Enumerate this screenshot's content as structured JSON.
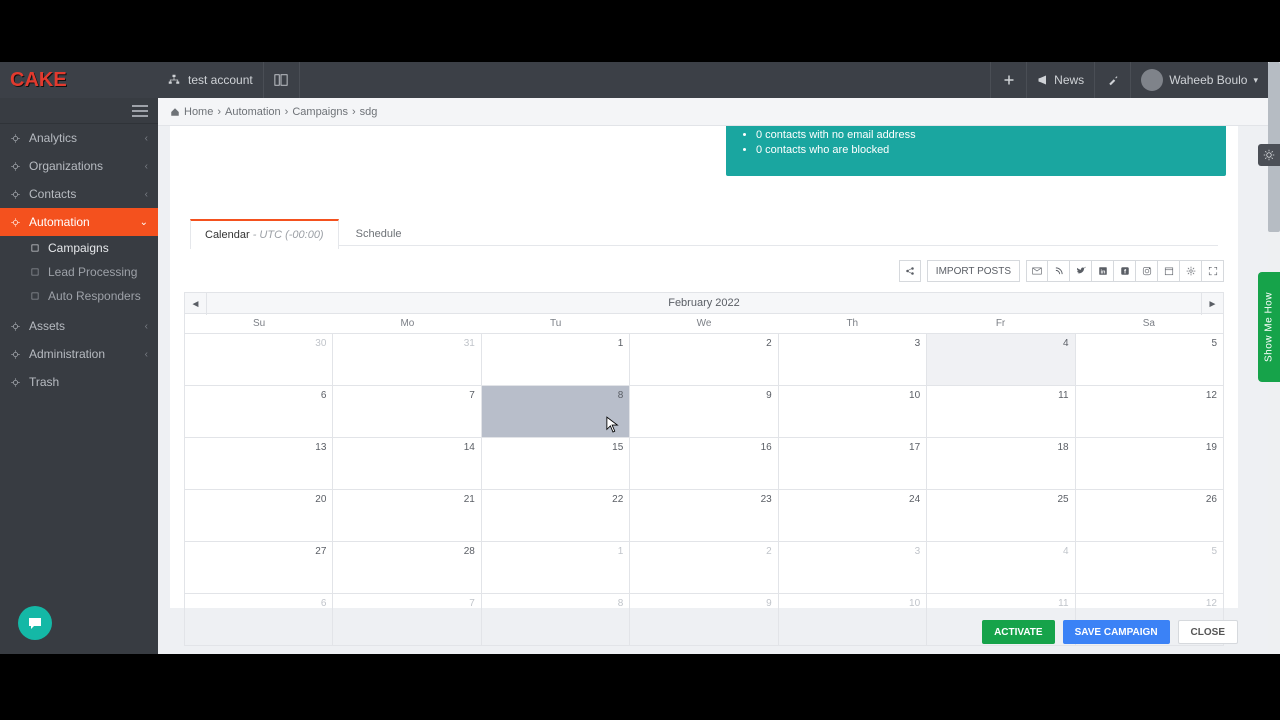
{
  "brand": "CAKE",
  "topbar": {
    "account_label": "test account",
    "news_label": "News",
    "user_name": "Waheeb Boulo"
  },
  "breadcrumb": {
    "home": "Home",
    "automation": "Automation",
    "campaigns": "Campaigns",
    "current": "sdg"
  },
  "sidebar": {
    "items": [
      {
        "label": "Analytics",
        "expandable": true
      },
      {
        "label": "Organizations",
        "expandable": true
      },
      {
        "label": "Contacts",
        "expandable": true
      },
      {
        "label": "Automation",
        "expandable": true,
        "active": true
      },
      {
        "label": "Assets",
        "expandable": true
      },
      {
        "label": "Administration",
        "expandable": true
      },
      {
        "label": "Trash",
        "expandable": false
      }
    ],
    "automation_children": [
      {
        "label": "Campaigns",
        "selected": true
      },
      {
        "label": "Lead Processing",
        "selected": false
      },
      {
        "label": "Auto Responders",
        "selected": false
      }
    ]
  },
  "notice": {
    "lines": [
      "0 contacts with no email address",
      "0 contacts who are blocked"
    ]
  },
  "tabs": {
    "calendar_label": "Calendar",
    "calendar_tz": " - UTC (-00:00)",
    "schedule_label": "Schedule"
  },
  "toolbar": {
    "import_label": "IMPORT POSTS"
  },
  "calendar": {
    "title": "February 2022",
    "dow": [
      "Su",
      "Mo",
      "Tu",
      "We",
      "Th",
      "Fr",
      "Sa"
    ],
    "rows": [
      [
        {
          "n": "30",
          "other": true
        },
        {
          "n": "31",
          "other": true
        },
        {
          "n": "1"
        },
        {
          "n": "2"
        },
        {
          "n": "3"
        },
        {
          "n": "4",
          "today": true
        },
        {
          "n": "5"
        }
      ],
      [
        {
          "n": "6"
        },
        {
          "n": "7"
        },
        {
          "n": "8",
          "hover": true
        },
        {
          "n": "9"
        },
        {
          "n": "10"
        },
        {
          "n": "11"
        },
        {
          "n": "12"
        }
      ],
      [
        {
          "n": "13"
        },
        {
          "n": "14"
        },
        {
          "n": "15"
        },
        {
          "n": "16"
        },
        {
          "n": "17"
        },
        {
          "n": "18"
        },
        {
          "n": "19"
        }
      ],
      [
        {
          "n": "20"
        },
        {
          "n": "21"
        },
        {
          "n": "22"
        },
        {
          "n": "23"
        },
        {
          "n": "24"
        },
        {
          "n": "25"
        },
        {
          "n": "26"
        }
      ],
      [
        {
          "n": "27"
        },
        {
          "n": "28"
        },
        {
          "n": "1",
          "other": true
        },
        {
          "n": "2",
          "other": true
        },
        {
          "n": "3",
          "other": true
        },
        {
          "n": "4",
          "other": true
        },
        {
          "n": "5",
          "other": true
        }
      ],
      [
        {
          "n": "6",
          "other": true
        },
        {
          "n": "7",
          "other": true
        },
        {
          "n": "8",
          "other": true
        },
        {
          "n": "9",
          "other": true
        },
        {
          "n": "10",
          "other": true
        },
        {
          "n": "11",
          "other": true
        },
        {
          "n": "12",
          "other": true
        }
      ]
    ]
  },
  "footer": {
    "activate": "ACTIVATE",
    "save": "SAVE CAMPAIGN",
    "close": "CLOSE"
  },
  "side": {
    "show_me": "Show Me How"
  }
}
